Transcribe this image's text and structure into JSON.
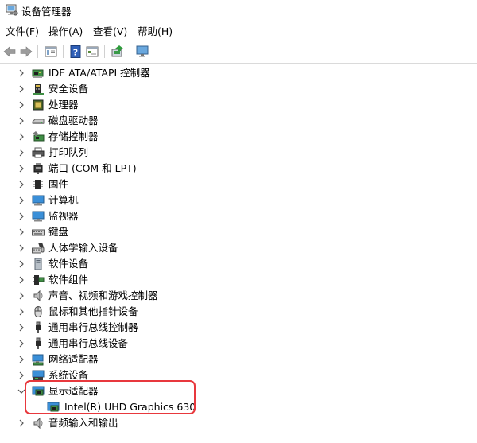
{
  "window": {
    "title": "设备管理器"
  },
  "menu": [
    {
      "label": "文件(F)"
    },
    {
      "label": "操作(A)"
    },
    {
      "label": "查看(V)"
    },
    {
      "label": "帮助(H)"
    }
  ],
  "tree": {
    "categories": [
      {
        "label": "IDE ATA/ATAPI 控制器",
        "icon": "ide-controller-icon",
        "expanded": false
      },
      {
        "label": "安全设备",
        "icon": "security-device-icon",
        "expanded": false
      },
      {
        "label": "处理器",
        "icon": "processor-icon",
        "expanded": false
      },
      {
        "label": "磁盘驱动器",
        "icon": "disk-drive-icon",
        "expanded": false
      },
      {
        "label": "存储控制器",
        "icon": "storage-controller-icon",
        "expanded": false
      },
      {
        "label": "打印队列",
        "icon": "printer-icon",
        "expanded": false
      },
      {
        "label": "端口 (COM 和 LPT)",
        "icon": "port-icon",
        "expanded": false
      },
      {
        "label": "固件",
        "icon": "firmware-icon",
        "expanded": false
      },
      {
        "label": "计算机",
        "icon": "computer-icon",
        "expanded": false
      },
      {
        "label": "监视器",
        "icon": "monitor-icon",
        "expanded": false
      },
      {
        "label": "键盘",
        "icon": "keyboard-icon",
        "expanded": false
      },
      {
        "label": "人体学输入设备",
        "icon": "hid-icon",
        "expanded": false
      },
      {
        "label": "软件设备",
        "icon": "software-device-icon",
        "expanded": false
      },
      {
        "label": "软件组件",
        "icon": "software-component-icon",
        "expanded": false
      },
      {
        "label": "声音、视频和游戏控制器",
        "icon": "speaker-icon",
        "expanded": false
      },
      {
        "label": "鼠标和其他指针设备",
        "icon": "mouse-icon",
        "expanded": false
      },
      {
        "label": "通用串行总线控制器",
        "icon": "usb-icon",
        "expanded": false
      },
      {
        "label": "通用串行总线设备",
        "icon": "usb-device-icon",
        "expanded": false
      },
      {
        "label": "网络适配器",
        "icon": "network-adapter-icon",
        "expanded": false
      },
      {
        "label": "系统设备",
        "icon": "system-device-icon",
        "expanded": false
      },
      {
        "label": "显示适配器",
        "icon": "display-adapter-icon",
        "expanded": true,
        "children": [
          {
            "label": "Intel(R) UHD Graphics 630",
            "icon": "display-adapter-icon"
          }
        ]
      },
      {
        "label": "音频输入和输出",
        "icon": "audio-io-icon",
        "expanded": false
      }
    ]
  },
  "colors": {
    "highlight_border": "#e8383d",
    "icon_blue": "#1f6fbf",
    "icon_green": "#2e9c3c"
  }
}
